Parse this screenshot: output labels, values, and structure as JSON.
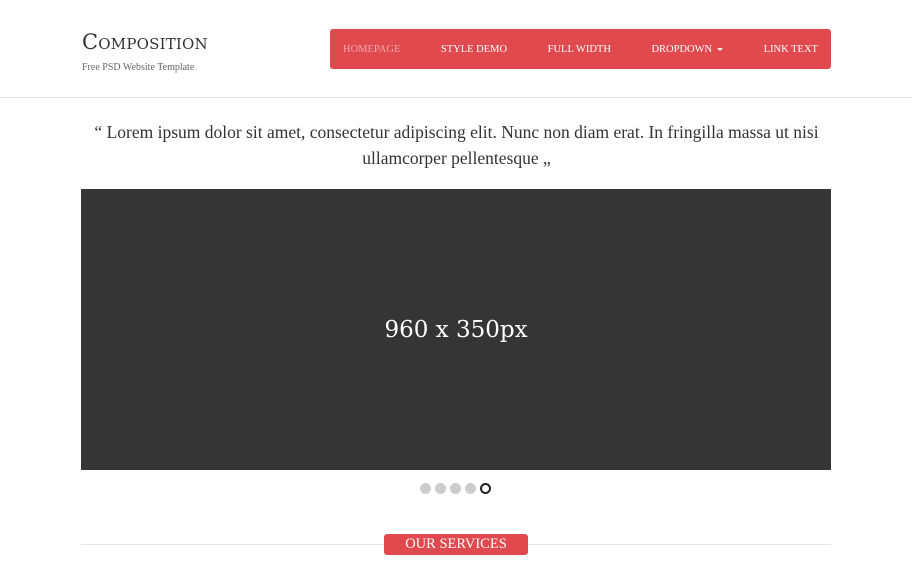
{
  "brand": {
    "title": "Composition",
    "subtitle": "Free PSD Website Template"
  },
  "nav": {
    "items": [
      {
        "label": "Homepage",
        "active": true
      },
      {
        "label": "Style Demo"
      },
      {
        "label": "Full Width"
      },
      {
        "label": "Dropdown",
        "has_dropdown": true
      },
      {
        "label": "Link Text"
      }
    ]
  },
  "quote": {
    "text": "“ Lorem ipsum dolor sit amet, consectetur adipiscing elit. Nunc non diam erat. In fringilla massa ut nisi ullamcorper pellentesque „"
  },
  "slider": {
    "placeholder": "960 x 350px",
    "slide_count": 5,
    "active_slide": 5
  },
  "services": {
    "label": "Our Services"
  },
  "colors": {
    "accent": "#e04a4f",
    "slider_bg": "#353535"
  }
}
